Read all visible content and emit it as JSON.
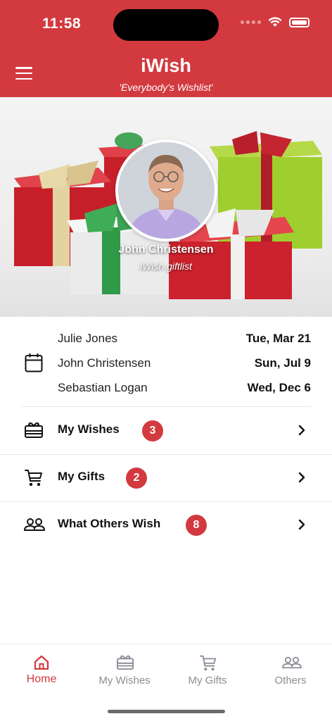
{
  "status_bar": {
    "time": "11:58"
  },
  "header": {
    "title": "iWish",
    "subtitle": "'Everybody's Wishlist'"
  },
  "profile": {
    "name": "John Christensen",
    "tagline": "iWish giftlist"
  },
  "birthdays": [
    {
      "name": "Julie Jones",
      "date": "Tue, Mar 21"
    },
    {
      "name": "John Christensen",
      "date": "Sun, Jul 9"
    },
    {
      "name": "Sebastian Logan",
      "date": "Wed, Dec 6"
    }
  ],
  "menu": [
    {
      "label": "My Wishes",
      "badge": "3",
      "icon": "gift-card-icon"
    },
    {
      "label": "My Gifts",
      "badge": "2",
      "icon": "shopping-cart-icon"
    },
    {
      "label": "What Others Wish",
      "badge": "8",
      "icon": "people-icon"
    }
  ],
  "tabs": [
    {
      "label": "Home",
      "icon": "home-icon",
      "active": true
    },
    {
      "label": "My Wishes",
      "icon": "gift-card-icon",
      "active": false
    },
    {
      "label": "My Gifts",
      "icon": "shopping-cart-icon",
      "active": false
    },
    {
      "label": "Others",
      "icon": "people-icon",
      "active": false
    }
  ],
  "colors": {
    "accent": "#d23a3f",
    "tab_inactive": "#8a8d96"
  }
}
